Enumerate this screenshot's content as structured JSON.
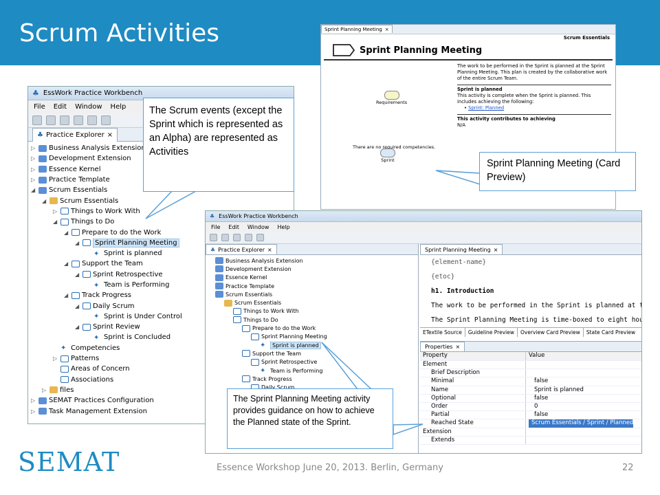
{
  "slide": {
    "title": "Scrum Activities",
    "footer": "Essence Workshop June 20, 2013. Berlin, Germany",
    "page_number": "22",
    "logo_text": "SEMAT"
  },
  "card_preview": {
    "tab_label": "Sprint Planning Meeting",
    "section_label": "Scrum Essentials",
    "title": "Sprint Planning Meeting",
    "description": "The work to be performed in the Sprint is planned at the Sprint Planning Meeting. This plan is created by the collaborative work of the entire Scrum Team.",
    "state_heading": "Sprint is planned",
    "state_text": "This activity is complete when the Sprint is planned. This includes achieving the following:",
    "state_link": "Sprint: Planned",
    "contributes_heading": "This activity contributes to achieving",
    "contributes_value": "N/A",
    "input_label": "Requirements",
    "output_label": "Sprint",
    "competencies_text": "There are no required competencies."
  },
  "workbench1": {
    "title": "EssWork Practice Workbench",
    "menu": [
      "File",
      "Edit",
      "Window",
      "Help"
    ],
    "view_tab": "Practice Explorer",
    "tree": [
      {
        "label": "Business Analysis Extension",
        "indent": 0,
        "toggle": "▷",
        "icon": "folder"
      },
      {
        "label": "Development Extension",
        "indent": 0,
        "toggle": "▷",
        "icon": "folder"
      },
      {
        "label": "Essence Kernel",
        "indent": 0,
        "toggle": "▷",
        "icon": "folder"
      },
      {
        "label": "Practice Template",
        "indent": 0,
        "toggle": "▷",
        "icon": "folder"
      },
      {
        "label": "Scrum Essentials",
        "indent": 0,
        "toggle": "◢",
        "icon": "folder"
      },
      {
        "label": "Scrum Essentials",
        "indent": 1,
        "toggle": "◢",
        "icon": "pkg"
      },
      {
        "label": "Things to Work With",
        "indent": 2,
        "toggle": "▷",
        "icon": "act"
      },
      {
        "label": "Things to Do",
        "indent": 2,
        "toggle": "◢",
        "icon": "act"
      },
      {
        "label": "Prepare to do the Work",
        "indent": 3,
        "toggle": "◢",
        "icon": "act"
      },
      {
        "label": "Sprint Planning Meeting",
        "indent": 4,
        "toggle": "◢",
        "icon": "act",
        "selected": true
      },
      {
        "label": "Sprint is planned",
        "indent": 5,
        "toggle": "",
        "icon": "state"
      },
      {
        "label": "Support the Team",
        "indent": 3,
        "toggle": "◢",
        "icon": "act"
      },
      {
        "label": "Sprint Retrospective",
        "indent": 4,
        "toggle": "◢",
        "icon": "act"
      },
      {
        "label": "Team is Performing",
        "indent": 5,
        "toggle": "",
        "icon": "state"
      },
      {
        "label": "Track Progress",
        "indent": 3,
        "toggle": "◢",
        "icon": "act"
      },
      {
        "label": "Daily Scrum",
        "indent": 4,
        "toggle": "◢",
        "icon": "act"
      },
      {
        "label": "Sprint is Under Control",
        "indent": 5,
        "toggle": "",
        "icon": "state"
      },
      {
        "label": "Sprint Review",
        "indent": 4,
        "toggle": "◢",
        "icon": "act"
      },
      {
        "label": "Sprint is Concluded",
        "indent": 5,
        "toggle": "",
        "icon": "state"
      },
      {
        "label": "Competencies",
        "indent": 2,
        "toggle": "",
        "icon": "state"
      },
      {
        "label": "Patterns",
        "indent": 2,
        "toggle": "▷",
        "icon": "act"
      },
      {
        "label": "Areas of Concern",
        "indent": 2,
        "toggle": "",
        "icon": "act"
      },
      {
        "label": "Associations",
        "indent": 2,
        "toggle": "",
        "icon": "act"
      },
      {
        "label": "files",
        "indent": 1,
        "toggle": "▷",
        "icon": "pkg"
      },
      {
        "label": "SEMAT Practices Configuration",
        "indent": 0,
        "toggle": "▷",
        "icon": "folder"
      },
      {
        "label": "Task Management Extension",
        "indent": 0,
        "toggle": "▷",
        "icon": "folder"
      }
    ]
  },
  "workbench2": {
    "title": "EssWork Practice Workbench",
    "menu": [
      "File",
      "Edit",
      "Window",
      "Help"
    ],
    "view_tab": "Practice Explorer",
    "editor_tab": "Sprint Planning Meeting",
    "tree": [
      {
        "label": "Business Analysis Extension",
        "indent": 0,
        "icon": "folder"
      },
      {
        "label": "Development Extension",
        "indent": 0,
        "icon": "folder"
      },
      {
        "label": "Essence Kernel",
        "indent": 0,
        "icon": "folder"
      },
      {
        "label": "Practice Template",
        "indent": 0,
        "icon": "folder"
      },
      {
        "label": "Scrum Essentials",
        "indent": 0,
        "icon": "folder"
      },
      {
        "label": "Scrum Essentials",
        "indent": 1,
        "icon": "pkg"
      },
      {
        "label": "Things to Work With",
        "indent": 2,
        "icon": "act"
      },
      {
        "label": "Things to Do",
        "indent": 2,
        "icon": "act"
      },
      {
        "label": "Prepare to do the Work",
        "indent": 3,
        "icon": "act"
      },
      {
        "label": "Sprint Planning Meeting",
        "indent": 4,
        "icon": "act"
      },
      {
        "label": "Sprint is planned",
        "indent": 5,
        "icon": "state",
        "selected": true
      },
      {
        "label": "Support the Team",
        "indent": 3,
        "icon": "act"
      },
      {
        "label": "Sprint Retrospective",
        "indent": 4,
        "icon": "act"
      },
      {
        "label": "Team is Performing",
        "indent": 5,
        "icon": "state"
      },
      {
        "label": "Track Progress",
        "indent": 3,
        "icon": "act"
      },
      {
        "label": "Daily Scrum",
        "indent": 4,
        "icon": "act"
      }
    ],
    "editor_lines": [
      "{element-name}",
      "{etoc}",
      "h1. Introduction",
      "The work to be performed in the Sprint is planned at the Sprint",
      "The Sprint Planning Meeting is time-boxed to eight hours for a"
    ],
    "editor_tabs": [
      "ETextile Source",
      "Guideline Preview",
      "Overview Card Preview",
      "State Card Preview"
    ],
    "properties_tab": "Properties",
    "properties_headers": [
      "Property",
      "Value"
    ],
    "properties": [
      {
        "name": "Element",
        "value": "",
        "indent": 0
      },
      {
        "name": "Brief Description",
        "value": "",
        "indent": 1
      },
      {
        "name": "Minimal",
        "value": "false",
        "indent": 1
      },
      {
        "name": "Name",
        "value": "Sprint is planned",
        "indent": 1
      },
      {
        "name": "Optional",
        "value": "false",
        "indent": 1
      },
      {
        "name": "Order",
        "value": "0",
        "indent": 1
      },
      {
        "name": "Partial",
        "value": "false",
        "indent": 1
      },
      {
        "name": "Reached State",
        "value": "Scrum Essentials / Sprint / Planned",
        "indent": 1,
        "selected": true
      },
      {
        "name": "Extension",
        "value": "",
        "indent": 0
      },
      {
        "name": "Extends",
        "value": "",
        "indent": 1
      }
    ]
  },
  "callouts": {
    "events": "The Scrum events (except the Sprint which is represented as an Alpha) are represented as Activities",
    "card_preview": "Sprint Planning Meeting (Card Preview)",
    "guidance": "The Sprint Planning Meeting activity provides guidance on how to achieve the Planned state of the Sprint."
  },
  "colors": {
    "header": "#1e8bc3",
    "callout_border": "#5aa0d8",
    "selection": "#cde4f7"
  }
}
